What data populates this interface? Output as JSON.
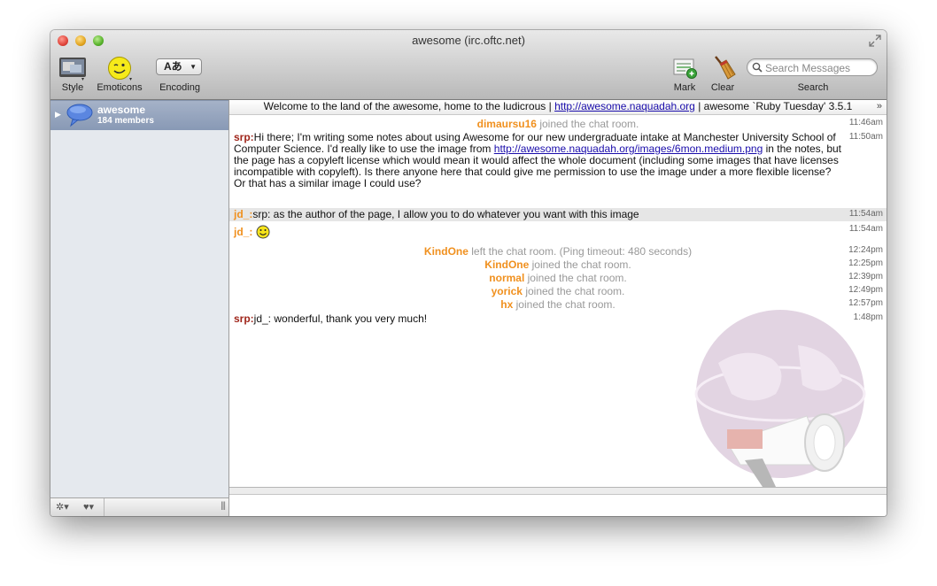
{
  "window": {
    "title": "awesome (irc.oftc.net)"
  },
  "toolbar": {
    "style_label": "Style",
    "emoticons_label": "Emoticons",
    "encoding_label": "Encoding",
    "encoding_value": "Aあ",
    "mark_label": "Mark",
    "clear_label": "Clear",
    "search_label": "Search",
    "search_placeholder": "Search Messages"
  },
  "sidebar": {
    "room": {
      "name": "awesome",
      "members": "184 members"
    }
  },
  "topic": {
    "before": "Welcome to the land of the awesome, home to the ludicrous |",
    "link": "http://awesome.naquadah.org",
    "after": "| awesome `Ruby Tuesday' 3.5.1"
  },
  "messages": [
    {
      "type": "event",
      "nick": "dimaursu16",
      "text": "joined the chat room.",
      "time": "11:46am"
    },
    {
      "type": "message",
      "nick": "srp:",
      "text_before": "Hi there; I'm writing some notes about using Awesome for our new undergraduate intake at Manchester University School of Computer Science. I'd really like to use the image from",
      "link": "http://awesome.naquadah.org/images/6mon.medium.png",
      "text_after": "in the notes, but the page has a copyleft license which would mean it would affect the whole document (including some images that have licenses incompatible with copyleft). Is there anyone here that could give me permission to use the image under a more flexible license? Or that has a similar image I could use?",
      "time": "11:50am"
    },
    {
      "type": "message",
      "nick": "jd_:",
      "text": "srp: as the author of the page, I allow you to do whatever you want with this image",
      "time": "11:54am"
    },
    {
      "type": "message",
      "nick": "jd_:",
      "text": "",
      "emoticon": "smiley-icon",
      "time": "11:54am"
    },
    {
      "type": "event",
      "nick": "KindOne",
      "text": "left the chat room. (Ping timeout: 480 seconds)",
      "time": "12:24pm"
    },
    {
      "type": "event",
      "nick": "KindOne",
      "text": "joined the chat room.",
      "time": "12:25pm"
    },
    {
      "type": "event",
      "nick": "normal",
      "text": "joined the chat room.",
      "time": "12:39pm"
    },
    {
      "type": "event",
      "nick": "yorick",
      "text": "joined the chat room.",
      "time": "12:49pm"
    },
    {
      "type": "event",
      "nick": "hx",
      "text": "joined the chat room.",
      "time": "12:57pm"
    },
    {
      "type": "message",
      "nick": "srp:",
      "text": "jd_: wonderful, thank you very much!",
      "time": "1:48pm"
    }
  ],
  "colors": {
    "own_nick": "#a0271c",
    "other_nick": "#f0901e",
    "link": "#1a0dab"
  }
}
